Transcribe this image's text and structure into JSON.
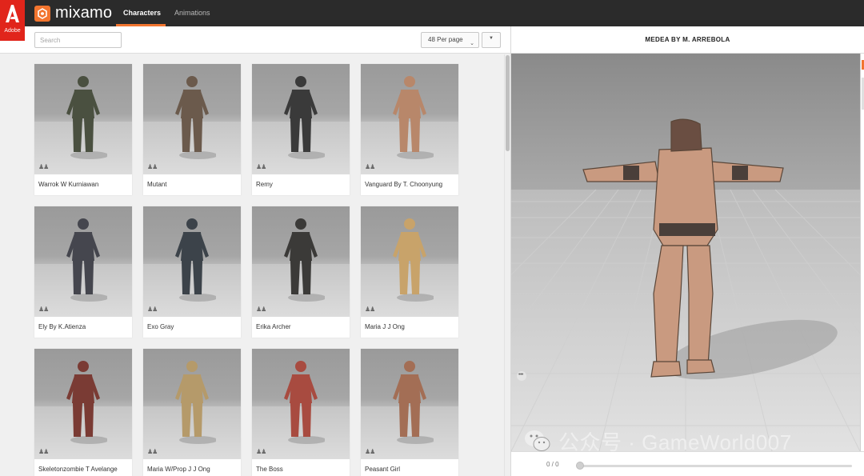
{
  "brand": {
    "adobe_label": "Adobe",
    "name": "mixamo",
    "accent": "#f2752f",
    "adobe_red": "#e1251b"
  },
  "nav": {
    "tabs": [
      {
        "label": "Characters",
        "active": true
      },
      {
        "label": "Animations",
        "active": false
      }
    ]
  },
  "toolbar": {
    "search_placeholder": "Search",
    "per_page": "48 Per page",
    "sort_icon": "caret-down-icon"
  },
  "characters": [
    {
      "name": "Warrok W Kurniawan",
      "tone": "#4a5040"
    },
    {
      "name": "Mutant",
      "tone": "#6b5a4c"
    },
    {
      "name": "Remy",
      "tone": "#3a3a3a"
    },
    {
      "name": "Vanguard By T. Choonyung",
      "tone": "#b8876a"
    },
    {
      "name": "Ely By K.Atienza",
      "tone": "#45464e"
    },
    {
      "name": "Exo Gray",
      "tone": "#3c434a"
    },
    {
      "name": "Erika Archer",
      "tone": "#3b3a38"
    },
    {
      "name": "Maria J J Ong",
      "tone": "#c8a36a"
    },
    {
      "name": "Skeletonzombie T Avelange",
      "tone": "#7a3b34"
    },
    {
      "name": "Maria W/Prop J J Ong",
      "tone": "#b59a6a"
    },
    {
      "name": "The Boss",
      "tone": "#a84b40"
    },
    {
      "name": "Peasant Girl",
      "tone": "#a36e55"
    }
  ],
  "preview": {
    "title": "MEDEA BY M. ARREBOLA",
    "model_color": "#c99a80"
  },
  "player": {
    "timecode": "0 / 0",
    "progress": 0
  },
  "watermark": {
    "text": "公众号 · GameWorld007"
  }
}
